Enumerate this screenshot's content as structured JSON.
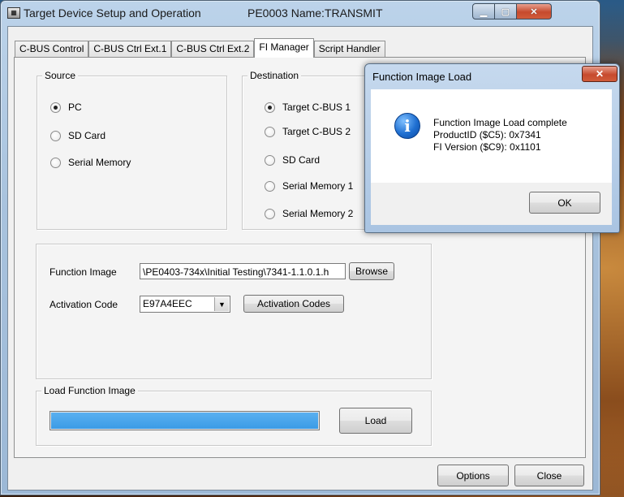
{
  "window": {
    "title": "Target Device Setup and Operation",
    "subtitle": "PE0003 Name:TRANSMIT"
  },
  "tabs": [
    "C-BUS Control",
    "C-BUS Ctrl Ext.1",
    "C-BUS Ctrl Ext.2",
    "FI Manager",
    "Script Handler"
  ],
  "active_tab": "FI Manager",
  "source": {
    "label": "Source",
    "options": [
      "PC",
      "SD Card",
      "Serial Memory"
    ],
    "selected": "PC"
  },
  "destination": {
    "label": "Destination",
    "options": [
      "Target C-BUS 1",
      "Target C-BUS 2",
      "SD Card",
      "Serial Memory 1",
      "Serial Memory 2"
    ],
    "selected": "Target C-BUS 1"
  },
  "function_image": {
    "label": "Function Image",
    "value": "\\PE0403-734x\\Initial Testing\\7341-1.1.0.1.h",
    "browse_label": "Browse"
  },
  "activation": {
    "label": "Activation Code",
    "value": "E97A4EEC",
    "codes_button": "Activation Codes"
  },
  "load_group": {
    "label": "Load Function Image",
    "progress": 1.0,
    "load_button": "Load"
  },
  "footer": {
    "options_button": "Options",
    "close_button": "Close"
  },
  "dialog": {
    "title": "Function Image Load",
    "lines": [
      "Function Image Load complete",
      "ProductID ($C5): 0x7341",
      "FI Version ($C9): 0x1101"
    ],
    "ok_label": "OK",
    "icon": "info-icon"
  }
}
